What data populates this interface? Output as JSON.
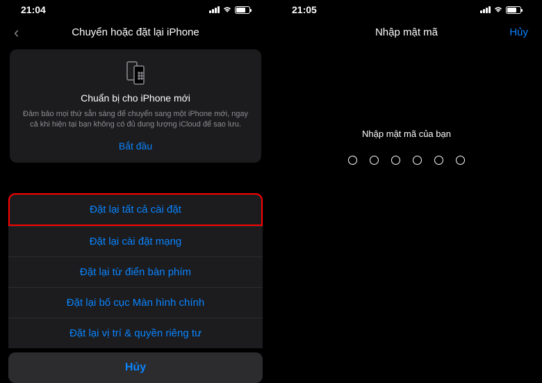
{
  "left": {
    "status_time": "21:04",
    "nav_title": "Chuyển hoặc đặt lại iPhone",
    "card": {
      "title": "Chuẩn bị cho iPhone mới",
      "desc": "Đảm bảo mọi thứ sẵn sàng để chuyển sang một iPhone mới, ngay cả khi hiện tại bạn không có đủ dung lượng iCloud để sao lưu.",
      "action": "Bắt đầu"
    },
    "sheet": {
      "item1": "Đặt lại tất cả cài đặt",
      "item2": "Đặt lại cài đặt mạng",
      "item3": "Đặt lại từ điển bàn phím",
      "item4": "Đặt lại bố cục Màn hình chính",
      "item5": "Đặt lại vị trí & quyền riêng tư",
      "cancel": "Hủy"
    }
  },
  "right": {
    "status_time": "21:05",
    "nav_title": "Nhập mật mã",
    "nav_action": "Hủy",
    "passcode_prompt": "Nhập mật mã của bạn"
  }
}
